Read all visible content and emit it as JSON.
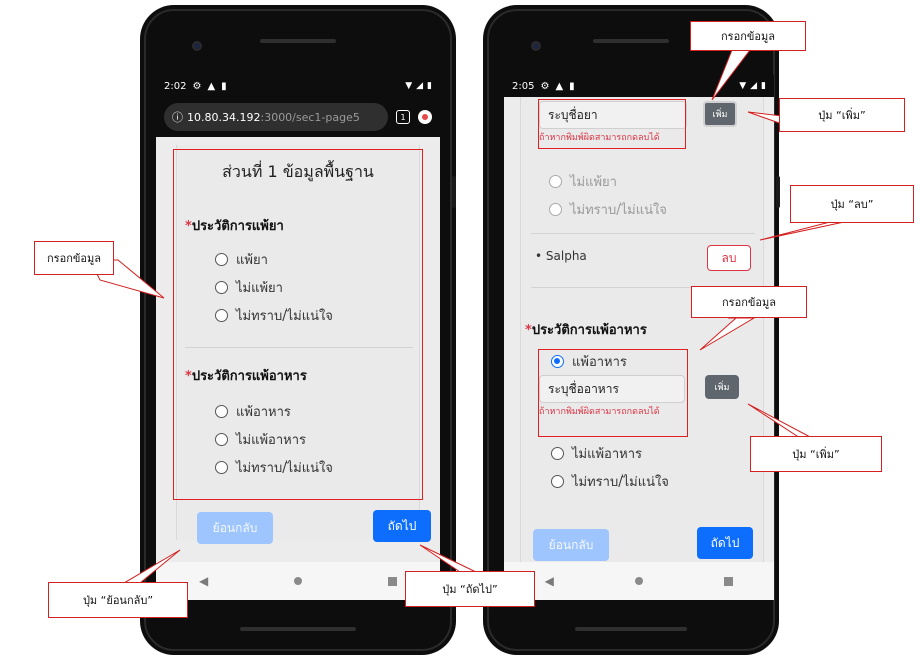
{
  "left_phone": {
    "status_time": "2:02",
    "url_host": "10.80.34.192",
    "url_path": ":3000/sec1-page5",
    "tab_count": "1",
    "section_title": "ส่วนที่ 1 ข้อมูลพื้นฐาน",
    "drug_allergy": {
      "label": "ประวัติการแพ้ยา",
      "options": [
        "แพ้ยา",
        "ไม่แพ้ยา",
        "ไม่ทราบ/ไม่แน่ใจ"
      ]
    },
    "food_allergy": {
      "label": "ประวัติการแพ้อาหาร",
      "options": [
        "แพ้อาหาร",
        "ไม่แพ้อาหาร",
        "ไม่ทราบ/ไม่แน่ใจ"
      ]
    },
    "back_button": "ย้อนกลับ",
    "next_button": "ถัดไป"
  },
  "right_phone": {
    "status_time": "2:05",
    "drug_input_placeholder": "ระบุชื่อยา",
    "add_button": "เพิ่ม",
    "error_text": "ถ้าหากพิมพ์ผิดสามารถกดลบได้",
    "drug_options": [
      "ไม่แพ้ยา",
      "ไม่ทราบ/ไม่แน่ใจ"
    ],
    "listed_drug": "Salpha",
    "delete_button": "ลบ",
    "food_allergy_label": "ประวัติการแพ้อาหาร",
    "food_selected_option": "แพ้อาหาร",
    "food_input_placeholder": "ระบุชื่ออาหาร",
    "food_add_button": "เพิ่ม",
    "food_error_text": "ถ้าหากพิมพ์ผิดสามารถกดลบได้",
    "food_other_options": [
      "ไม่แพ้อาหาร",
      "ไม่ทราบ/ไม่แน่ใจ"
    ],
    "back_button": "ย้อนกลับ",
    "next_button": "ถัดไป"
  },
  "callouts": {
    "left_fill": "กรอกข้อมูล",
    "back": "ปุ่ม “ย้อนกลับ”",
    "next": "ปุ่ม “ถัดไป”",
    "right_fill_top": "กรอกข้อมูล",
    "add_top": "ปุ่ม “เพิ่ม”",
    "delete": "ปุ่ม “ลบ”",
    "right_fill_mid": "กรอกข้อมูล",
    "add_bottom": "ปุ่ม “เพิ่ม”"
  },
  "colors": {
    "primary": "#0d6efd",
    "primary_disabled": "#9ec5fe",
    "danger": "#dc3545",
    "callout_border": "#d32020"
  }
}
